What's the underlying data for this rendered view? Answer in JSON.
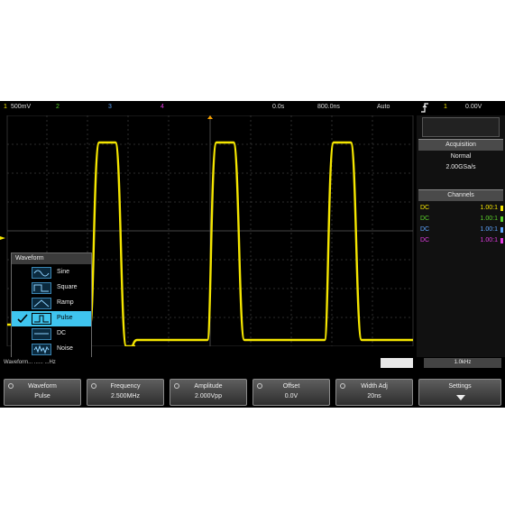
{
  "topbar": {
    "ch1_scale": "500mV",
    "ch2_scale": "2",
    "ch3_scale": "3",
    "ch4_scale": "4",
    "delay": "0.0s",
    "timebase": "800.0ns",
    "run_mode": "Auto",
    "trigger_channel": "1",
    "trigger_level": "0.00V"
  },
  "acquisition": {
    "title": "Acquisition",
    "mode": "Normal",
    "sample_rate": "2.00GSa/s"
  },
  "channels_panel": {
    "title": "Channels",
    "rows": [
      {
        "label": "DC",
        "value": "1.00:1",
        "color": "#f5e600"
      },
      {
        "label": "DC",
        "value": "1.00:1",
        "color": "#5ad12a"
      },
      {
        "label": "DC",
        "value": "1.00:1",
        "color": "#5ea6ff"
      },
      {
        "label": "DC",
        "value": "1.00:1",
        "color": "#e03ce0"
      }
    ]
  },
  "waveform_menu": {
    "title": "Waveform",
    "items": [
      {
        "label": "Sine",
        "icon": "sine-icon"
      },
      {
        "label": "Square",
        "icon": "square-wave-icon"
      },
      {
        "label": "Ramp",
        "icon": "ramp-icon"
      },
      {
        "label": "Pulse",
        "icon": "pulse-icon",
        "selected": true
      },
      {
        "label": "DC",
        "icon": "dc-icon"
      },
      {
        "label": "Noise",
        "icon": "noise-icon"
      }
    ]
  },
  "status": {
    "left": "Waveform... ...... ...Hz",
    "mid": "",
    "right": "1.0kHz"
  },
  "softkeys": [
    {
      "line1": "Waveform",
      "line2": "Pulse"
    },
    {
      "line1": "Frequency",
      "line2": "2.500MHz"
    },
    {
      "line1": "Amplitude",
      "line2": "2.000Vpp"
    },
    {
      "line1": "Offset",
      "line2": "0.0V"
    },
    {
      "line1": "Width Adj",
      "line2": "20ns"
    },
    {
      "line1": "Settings",
      "line2": ""
    }
  ],
  "colors": {
    "trace": "#f5e600",
    "highlight": "#3fc5ef",
    "grid": "#3a3a3a"
  }
}
